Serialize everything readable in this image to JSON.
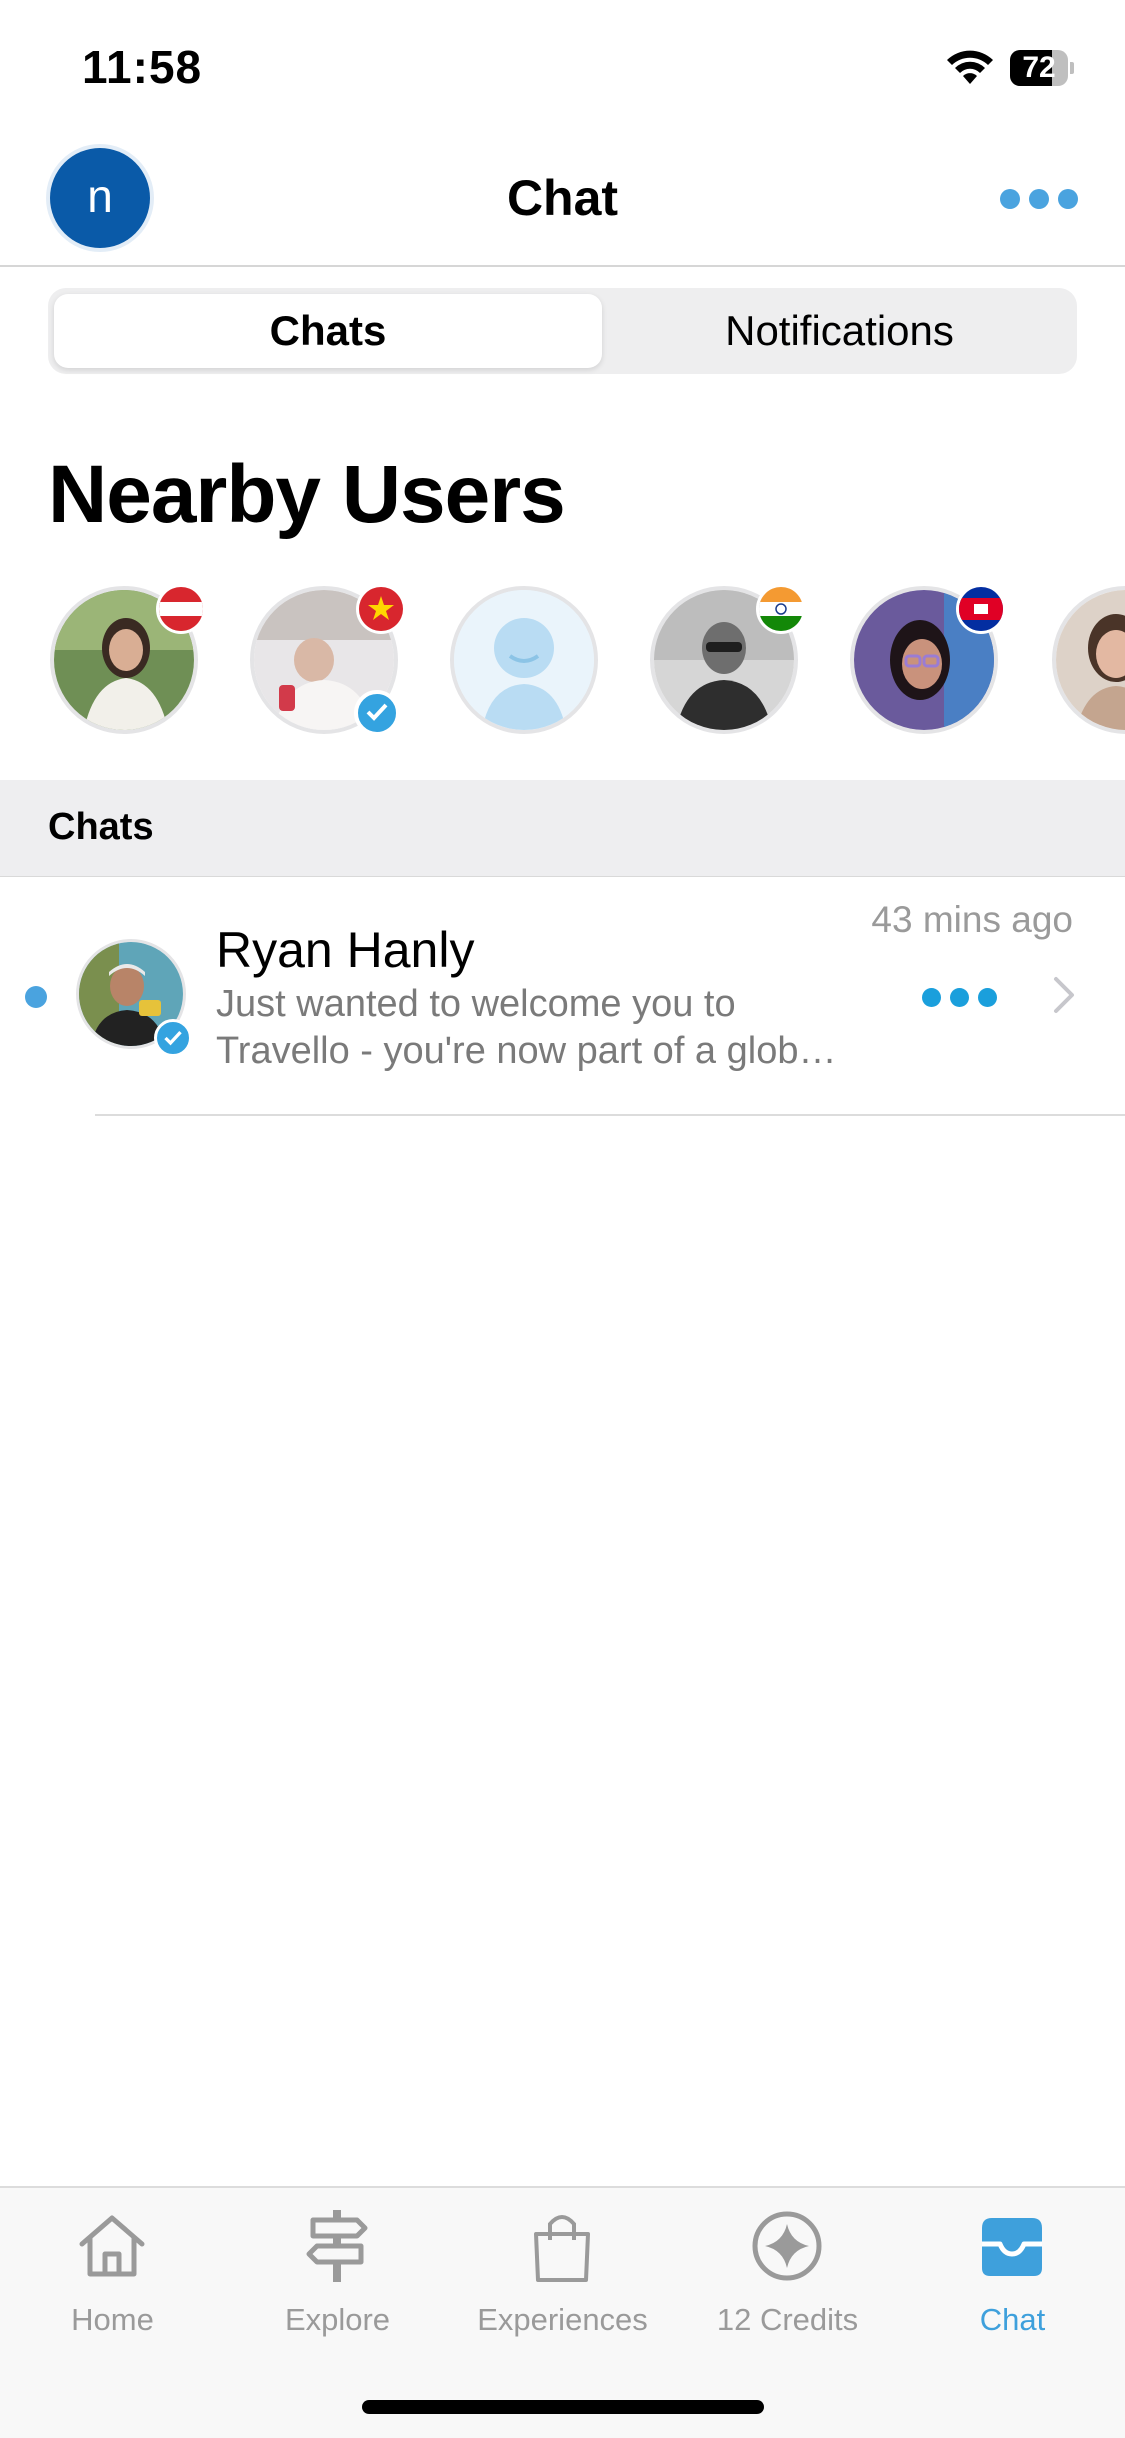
{
  "status_bar": {
    "time": "11:58",
    "battery": "72",
    "battery_level": 0.72
  },
  "header": {
    "avatar_initial": "n",
    "title": "Chat"
  },
  "segmented": {
    "chats": "Chats",
    "notifications": "Notifications"
  },
  "nearby": {
    "title": "Nearby Users",
    "users": [
      {
        "flag": "austria-flag",
        "verified": false
      },
      {
        "flag": "vietnam-flag",
        "verified": true
      },
      {
        "flag": "",
        "verified": false,
        "placeholder": true
      },
      {
        "flag": "india-flag",
        "verified": false
      },
      {
        "flag": "cambodia-flag",
        "verified": false
      },
      {
        "flag": "",
        "verified": false
      }
    ]
  },
  "section": {
    "title": "Chats"
  },
  "chats": [
    {
      "name": "Ryan Hanly",
      "time": "43 mins ago",
      "message_line1": "Just wanted to welcome you to",
      "message_line2": "Travello - you're now part of a glob…",
      "unread": true,
      "verified": true
    }
  ],
  "tabbar": {
    "items": [
      {
        "label": "Home",
        "icon": "home-icon"
      },
      {
        "label": "Explore",
        "icon": "signpost-icon"
      },
      {
        "label": "Experiences",
        "icon": "shopping-bag-icon"
      },
      {
        "label": "12 Credits",
        "icon": "credits-star-icon"
      },
      {
        "label": "Chat",
        "icon": "inbox-tray-icon"
      }
    ],
    "active": "Chat"
  },
  "colors": {
    "accent": "#3ea0dc",
    "avatar_bg": "#0a5aa8",
    "typing_dots": "#1a9fdc"
  }
}
